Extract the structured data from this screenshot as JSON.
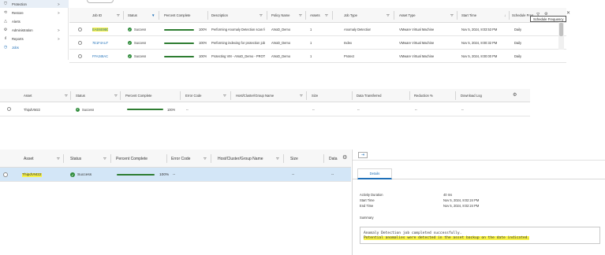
{
  "sidebar": {
    "items": [
      {
        "label": "Protection",
        "icon": "shield-icon",
        "glyph": "⛉",
        "chevron": true,
        "active": true
      },
      {
        "label": "Restore",
        "icon": "restore-icon",
        "glyph": "⟲",
        "chevron": true
      },
      {
        "label": "Alerts",
        "icon": "bell-icon",
        "glyph": "🔔",
        "chevron": false
      },
      {
        "label": "Administration",
        "icon": "admin-icon",
        "glyph": "⚙",
        "chevron": true
      },
      {
        "label": "Reports",
        "icon": "reports-icon",
        "glyph": "▮",
        "chevron": true
      },
      {
        "label": "Jobs",
        "icon": "jobs-icon",
        "glyph": "◷",
        "chevron": false
      }
    ]
  },
  "jobs_table": {
    "headers": [
      "Job ID",
      "Status",
      "Percent Complete",
      "Description",
      "Policy Name",
      "Assets",
      "Job Type",
      "Asset Type",
      "Start Time",
      "Schedule Freq"
    ],
    "tooltip": "Schedule Frequency",
    "rows": [
      {
        "job_id": "EAE6E9B0",
        "status": "Success",
        "percent": "100%",
        "percent_value": 100,
        "description": "Performing Anomaly Detection scan for Protect...",
        "policy": "ANoD_Demo",
        "assets": "1",
        "job_type": "Anomaly Detection",
        "asset_type": "VMware Virtual Machine",
        "start_time": "Nov 5, 2024, 8:03:53 PM",
        "schedule": "Daily",
        "highlight": true
      },
      {
        "job_id": "7E1F4AU7",
        "status": "Success",
        "percent": "100%",
        "percent_value": 100,
        "description": "Performing indexing for protection job FFA348A...",
        "policy": "ANoD_Demo",
        "assets": "1",
        "job_type": "Index",
        "asset_type": "VMware Virtual Machine",
        "start_time": "Nov 5, 2024, 8:00:32 PM",
        "schedule": "Daily",
        "highlight": false
      },
      {
        "job_id": "FFA348AC",
        "status": "Success",
        "percent": "100%",
        "percent_value": 100,
        "description": "Protecting VM - ANoD_Demo - PROTECTION - 5...",
        "policy": "ANoD_Demo",
        "assets": "1",
        "job_type": "Protect",
        "asset_type": "VMware Virtual Machine",
        "start_time": "Nov 5, 2024, 8:00:00 PM",
        "schedule": "Daily",
        "highlight": false
      }
    ]
  },
  "asset_table": {
    "headers": [
      "Asset",
      "Status",
      "Percent Complete",
      "Error Code",
      "Host/Cluster/Group Name",
      "Size",
      "Data Transferred",
      "Reduction %",
      "Download Log"
    ],
    "row": {
      "asset": "ThipdVM22",
      "status": "Success",
      "percent": "100%",
      "percent_value": 100,
      "error_code": "--",
      "host": "",
      "size": "--",
      "data_transferred": "--",
      "reduction": "--",
      "download_log": "--"
    }
  },
  "detail_view": {
    "headers": [
      "Asset",
      "Status",
      "Percent Complete",
      "Error Code",
      "Host/Cluster/Group Name",
      "Size",
      "Data"
    ],
    "row": {
      "asset": "ThipdVM22",
      "status": "Success",
      "percent": "100%",
      "percent_value": 100,
      "error_code": "--",
      "host": "",
      "size": "--",
      "data": "--"
    },
    "drawer": {
      "tab": "Details",
      "fields": [
        {
          "label": "Activity Duration",
          "value": "40 ms"
        },
        {
          "label": "Start Time",
          "value": "Nov 5, 2024, 8:02:24 PM"
        },
        {
          "label": "End Time",
          "value": "Nov 5, 2024, 8:02:24 PM"
        }
      ],
      "summary_label": "Summary",
      "summary_lines": [
        "Anomaly Detection job completed successfully.",
        "Potential anomalies were detected in the asset backup on the date indicated."
      ]
    }
  },
  "colors": {
    "accent": "#1e6fb8",
    "success": "#2e8b3a",
    "highlight": "#f7f24a",
    "selected_row": "#d3e6f7"
  }
}
